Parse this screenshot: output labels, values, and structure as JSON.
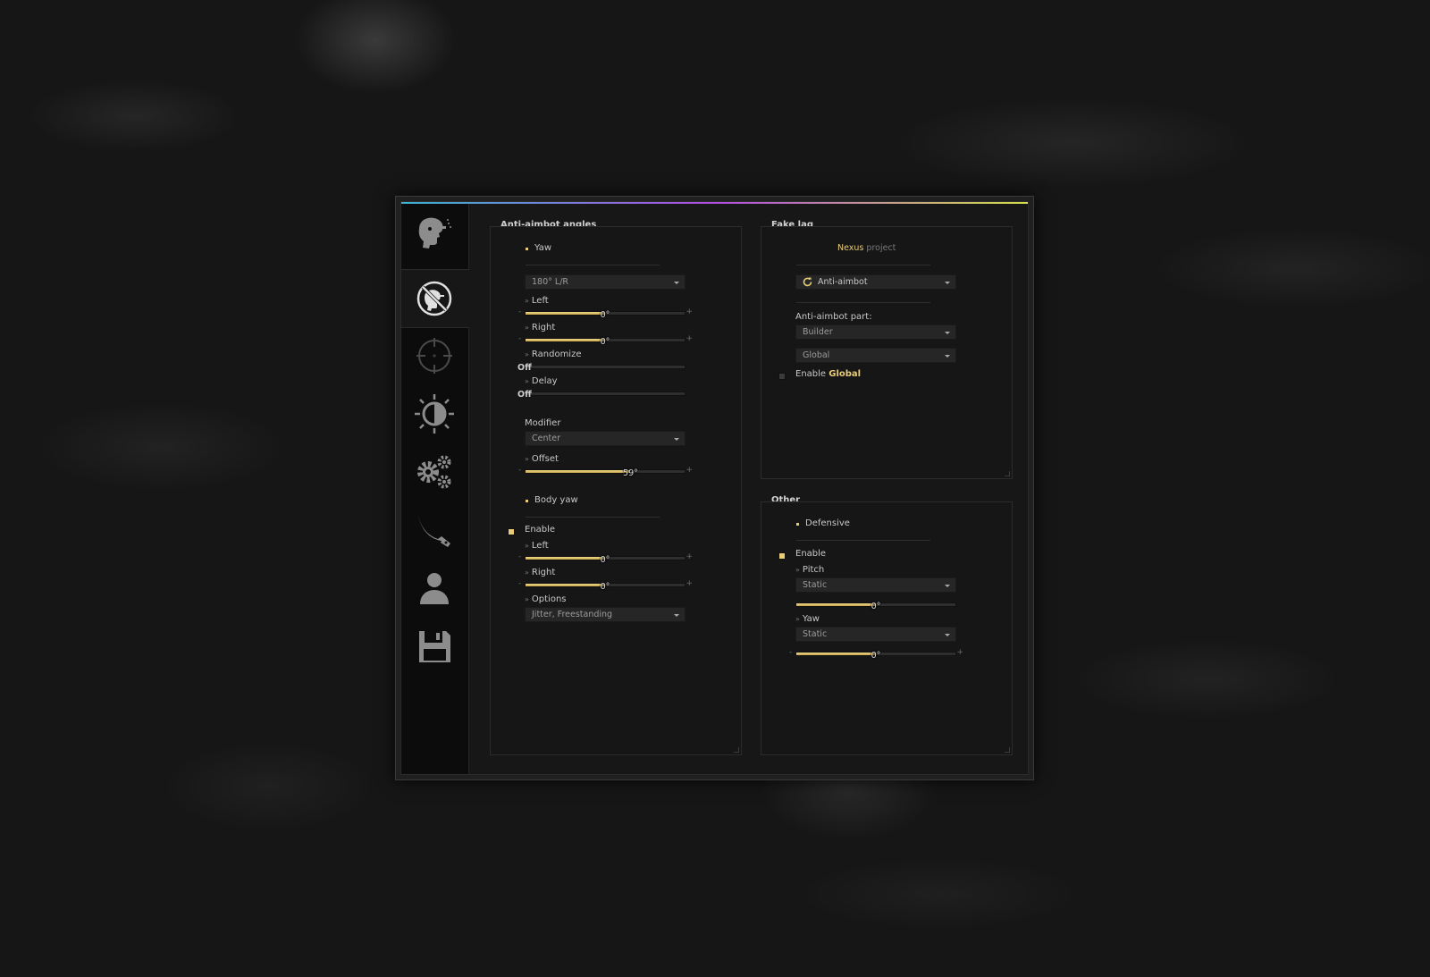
{
  "theme": {
    "accent": "#e8cc76",
    "background": "#171717",
    "sidebar": "#0c0c0c"
  },
  "sidebar": {
    "tabs": [
      {
        "icon": "ragebot-icon",
        "active": false
      },
      {
        "icon": "anti-aim-icon",
        "active": true
      },
      {
        "icon": "crosshair-icon",
        "active": false
      },
      {
        "icon": "visuals-icon",
        "active": false
      },
      {
        "icon": "misc-gears-icon",
        "active": false
      },
      {
        "icon": "knife-icon",
        "active": false
      },
      {
        "icon": "player-icon",
        "active": false
      },
      {
        "icon": "save-icon",
        "active": false
      }
    ]
  },
  "aa": {
    "title": "Anti-aimbot angles",
    "yaw_header": "Yaw",
    "yaw_value": "180° L/R",
    "left_label": "Left",
    "left_value": "0°",
    "left_pct": 0.5,
    "right_label": "Right",
    "right_value": "0°",
    "right_pct": 0.5,
    "randomize_label": "Randomize",
    "randomize_value": "Off",
    "delay_label": "Delay",
    "delay_value": "Off",
    "modifier_label": "Modifier",
    "modifier_value": "Center",
    "offset_label": "Offset",
    "offset_value": "59°",
    "offset_pct": 0.66,
    "body_header": "Body yaw",
    "enable_label": "Enable",
    "enable_checked": true,
    "body_left_label": "Left",
    "body_left_value": "0°",
    "body_left_pct": 0.5,
    "body_right_label": "Right",
    "body_right_value": "0°",
    "body_right_pct": 0.5,
    "options_label": "Options",
    "options_value": "Jitter, Freestanding",
    "slider_minus": "-",
    "slider_plus": "+"
  },
  "fakelag": {
    "title": "Fake lag",
    "brand_a": "Nexus",
    "brand_b": " project",
    "mode_value": "Anti-aimbot",
    "part_label": "Anti-aimbot part:",
    "part_value": "Builder",
    "scope_value": "Global",
    "enable_prefix": "Enable ",
    "enable_target": "Global",
    "enable_checked": false
  },
  "other": {
    "title": "Other",
    "header": "Defensive",
    "enable_label": "Enable",
    "enable_checked": true,
    "pitch_label": "Pitch",
    "pitch_value": "Static",
    "pitch_slider_value": "0°",
    "pitch_pct": 0.5,
    "yaw_label": "Yaw",
    "yaw_value": "Static",
    "yaw_slider_value": "0°",
    "yaw_pct": 0.5,
    "slider_minus": "-",
    "slider_plus": "+"
  }
}
